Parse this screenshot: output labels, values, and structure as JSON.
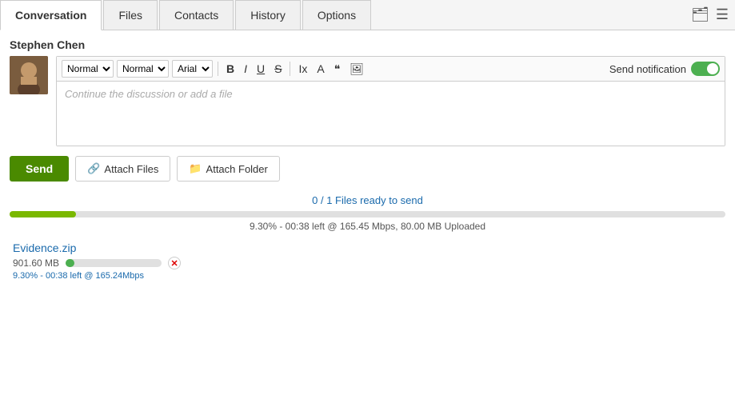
{
  "tabs": [
    {
      "label": "Conversation",
      "active": true
    },
    {
      "label": "Files",
      "active": false
    },
    {
      "label": "Contacts",
      "active": false
    },
    {
      "label": "History",
      "active": false
    },
    {
      "label": "Options",
      "active": false
    }
  ],
  "header_icons": {
    "case_icon": "🗂",
    "menu_icon": "☰"
  },
  "user": {
    "name": "Stephen Chen"
  },
  "toolbar": {
    "style1_options": [
      "Normal"
    ],
    "style1_value": "Normal",
    "style2_options": [
      "Normal"
    ],
    "style2_value": "Normal",
    "font_options": [
      "Arial"
    ],
    "font_value": "Arial",
    "bold_label": "B",
    "italic_label": "I",
    "underline_label": "U",
    "strike_label": "S",
    "clear_label": "Ix",
    "font_color_label": "A",
    "quote_label": "❝",
    "image_label": "🖼",
    "send_notification_label": "Send notification"
  },
  "editor": {
    "placeholder": "Continue the discussion or add a file"
  },
  "buttons": {
    "send": "Send",
    "attach_files": "Attach Files",
    "attach_folder": "Attach Folder"
  },
  "file_transfer": {
    "status_text": "0 / 1 Files ready to send",
    "progress_pct": 9.3,
    "upload_detail": "9.30% - 00:38 left @ 165.45 Mbps, 80.00 MB Uploaded",
    "file_name": "Evidence.zip",
    "file_size": "901.60 MB",
    "file_progress_pct": 9.3,
    "file_detail": "9.30% - 00:38 left @ 165.24Mbps"
  }
}
